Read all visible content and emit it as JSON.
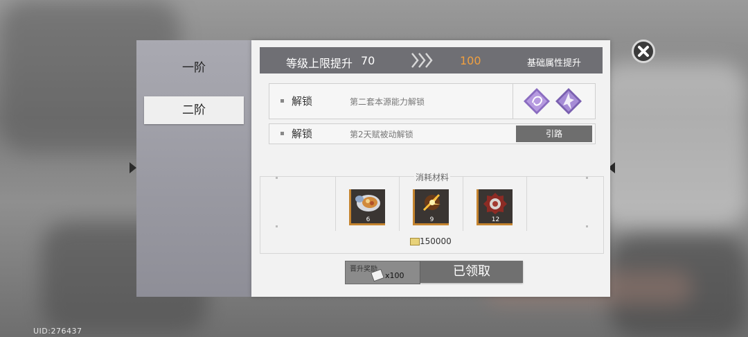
{
  "uid_text": "UID:276437",
  "stages": [
    {
      "label": "一阶",
      "selected": false
    },
    {
      "label": "二阶",
      "selected": true
    }
  ],
  "level_cap": {
    "title": "等级上限提升",
    "from": "70",
    "to": "100",
    "attribute_text": "基础属性提升"
  },
  "unlocks": [
    {
      "label": "解锁",
      "description": "第二套本源能力解锁",
      "icons": [
        "skill-swirl-icon",
        "skill-figure-icon"
      ]
    },
    {
      "label": "解锁",
      "description": "第2天赋被动解锁",
      "button_label": "引路"
    }
  ],
  "materials": {
    "title": "消耗材料",
    "items": [
      {
        "icon": "food-plate-icon",
        "count": "6"
      },
      {
        "icon": "spark-crystal-icon",
        "count": "9"
      },
      {
        "icon": "red-gear-icon",
        "count": "12"
      }
    ],
    "coin_amount": "150000"
  },
  "reward": {
    "title": "晋升奖励",
    "quantity": "x100"
  },
  "claimed_label": "已领取",
  "colors": {
    "header_bg": "#6f6f74",
    "level_to": "#f0a040",
    "item_border": "#c5842f",
    "card_bg": "#f2f2f2"
  }
}
